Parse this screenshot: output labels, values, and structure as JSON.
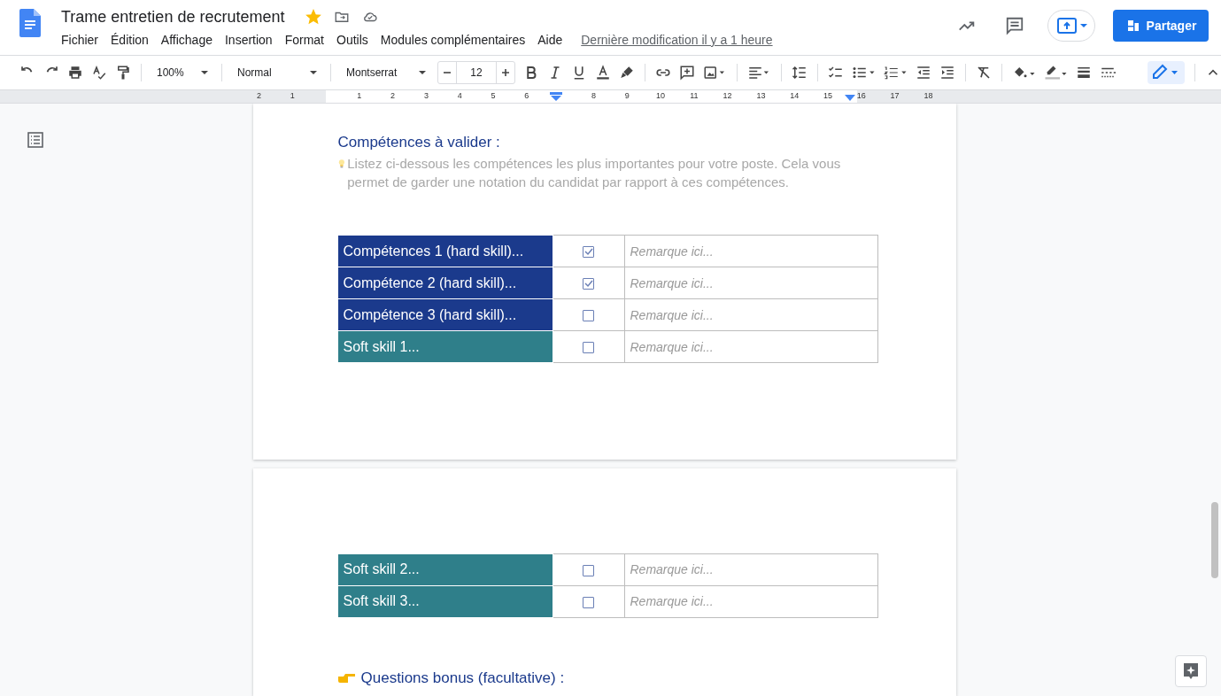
{
  "header": {
    "title": "Trame entretien de recrutement",
    "starred": true,
    "menus": [
      "Fichier",
      "Édition",
      "Affichage",
      "Insertion",
      "Format",
      "Outils",
      "Modules complémentaires",
      "Aide"
    ],
    "last_modified": "Dernière modification il y a 1 heure",
    "share_button": "Partager"
  },
  "toolbar": {
    "zoom": "100%",
    "style": "Normal",
    "font": "Montserrat",
    "font_size": "12",
    "edit_mode_selected": true
  },
  "ruler": {
    "labels": [
      "2",
      "1",
      "1",
      "2",
      "3",
      "4",
      "5",
      "6",
      "8",
      "9",
      "10",
      "11",
      "12",
      "13",
      "14",
      "15",
      "16",
      "17",
      "18"
    ]
  },
  "document": {
    "heading": "Compétences à valider :",
    "intro": "Listez ci-dessous les compétences les plus importantes pour votre poste. Cela vous permet de garder une notation du candidat par rapport à ces compétences.",
    "table_page_1": [
      {
        "skill": "Compétences 1 (hard skill)...",
        "color": "#1b3a8c",
        "checked": true,
        "remark": "Remarque ici..."
      },
      {
        "skill": "Compétence 2 (hard skill)...",
        "color": "#1b3a8c",
        "checked": true,
        "remark": "Remarque ici..."
      },
      {
        "skill": "Compétence 3 (hard skill)...",
        "color": "#1b3a8c",
        "checked": false,
        "remark": "Remarque ici..."
      },
      {
        "skill": "Soft skill 1...",
        "color": "#2f7f8a",
        "checked": false,
        "remark": "Remarque ici..."
      }
    ],
    "table_page_2": [
      {
        "skill": "Soft skill 2...",
        "color": "#2f7f8a",
        "checked": false,
        "remark": "Remarque ici..."
      },
      {
        "skill": "Soft skill 3...",
        "color": "#2f7f8a",
        "checked": false,
        "remark": "Remarque ici..."
      }
    ],
    "bonus_heading": "Questions bonus (facultative) :"
  }
}
